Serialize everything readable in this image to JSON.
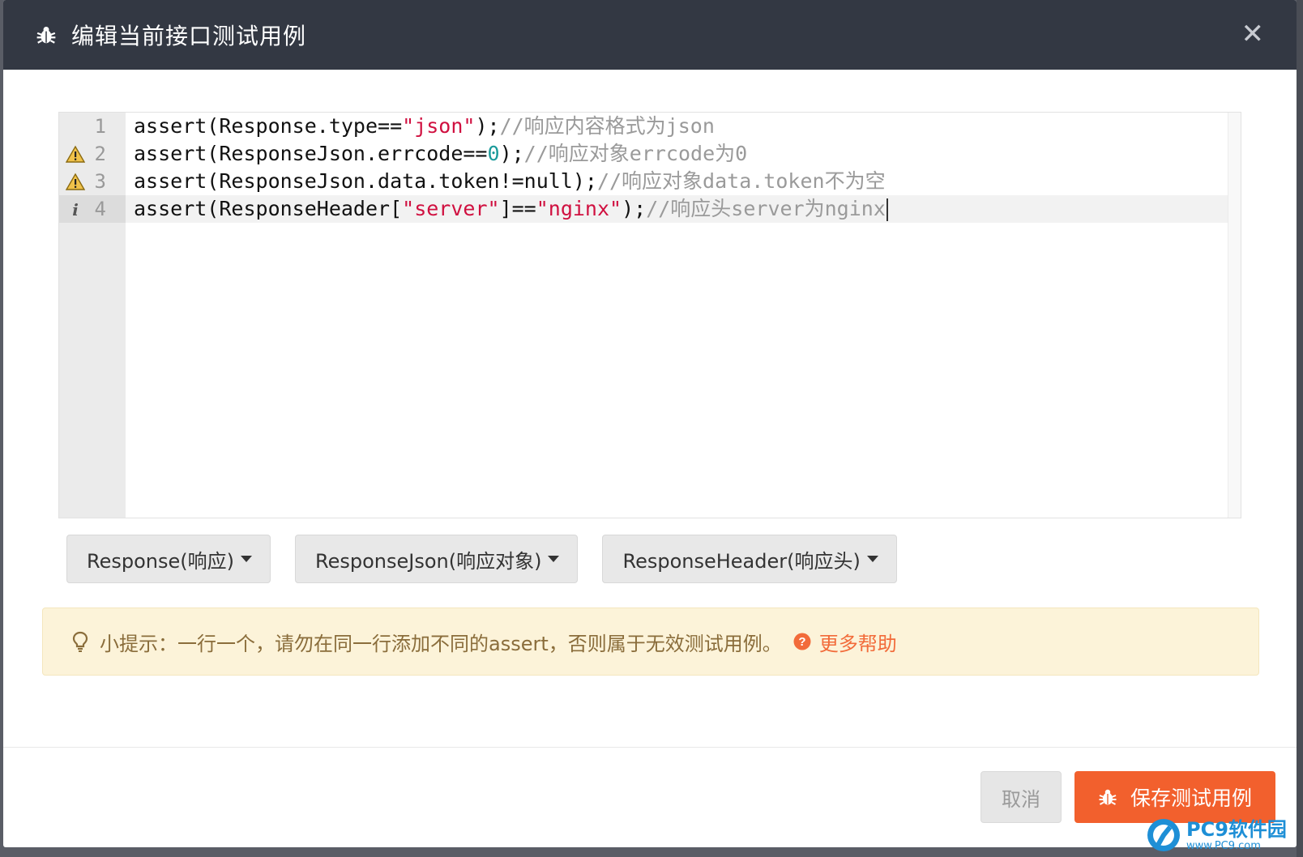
{
  "modal": {
    "title": "编辑当前接口测试用例",
    "close_icon": "close-icon",
    "title_icon": "bug-icon"
  },
  "editor": {
    "lines": [
      {
        "number": "1",
        "marker": "",
        "tokens": [
          {
            "t": "assert(Response.type==",
            "k": "plain"
          },
          {
            "t": "\"json\"",
            "k": "str"
          },
          {
            "t": ");",
            "k": "plain"
          },
          {
            "t": "//响应内容格式为json",
            "k": "com"
          }
        ]
      },
      {
        "number": "2",
        "marker": "warning",
        "tokens": [
          {
            "t": "assert(ResponseJson.errcode==",
            "k": "plain"
          },
          {
            "t": "0",
            "k": "num"
          },
          {
            "t": ");",
            "k": "plain"
          },
          {
            "t": "//响应对象errcode为0",
            "k": "com"
          }
        ]
      },
      {
        "number": "3",
        "marker": "warning",
        "tokens": [
          {
            "t": "assert(ResponseJson.data.token!=null);",
            "k": "plain"
          },
          {
            "t": "//响应对象data.token不为空",
            "k": "com"
          }
        ]
      },
      {
        "number": "4",
        "marker": "info",
        "tokens": [
          {
            "t": "assert(ResponseHeader[",
            "k": "plain"
          },
          {
            "t": "\"server\"",
            "k": "str"
          },
          {
            "t": "]==",
            "k": "plain"
          },
          {
            "t": "\"nginx\"",
            "k": "str"
          },
          {
            "t": ");",
            "k": "plain"
          },
          {
            "t": "//响应头server为nginx",
            "k": "com"
          }
        ]
      }
    ],
    "active_line": "4",
    "colors": {
      "string": "#d01040",
      "number": "#1a9a9a",
      "comment": "#9a9a9a"
    }
  },
  "dropdowns": [
    {
      "label": "Response(响应)"
    },
    {
      "label": "ResponseJson(响应对象)"
    },
    {
      "label": "ResponseHeader(响应头)"
    }
  ],
  "tip": {
    "icon": "lightbulb-icon",
    "text": "小提示：一行一个，请勿在同一行添加不同的assert，否则属于无效测试用例。",
    "help_icon": "question-circle-icon",
    "help_label": "更多帮助"
  },
  "footer": {
    "cancel_label": "取消",
    "save_label": "保存测试用例",
    "save_icon": "bug-icon"
  },
  "watermark": {
    "brand": "PC9软件园",
    "url": "www.PC9.com"
  },
  "theme": {
    "header_bg": "#333843",
    "accent": "#f2602d",
    "tip_bg": "#fcf3d9",
    "tip_text": "#8a6d3b"
  }
}
